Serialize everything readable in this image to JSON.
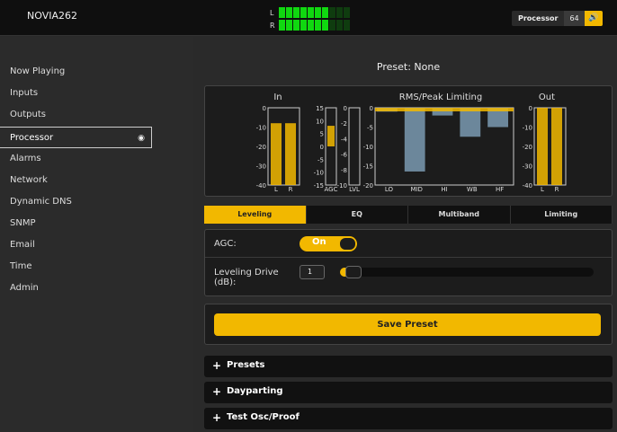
{
  "header": {
    "device_name": "NOVIA262",
    "vu": {
      "left_label": "L",
      "right_label": "R",
      "left_level": 0.7,
      "right_level": 0.7
    },
    "processor_label": "Processor",
    "processor_value": "64",
    "volume_icon": "speaker-icon"
  },
  "sidebar": {
    "items": [
      {
        "label": "Now Playing"
      },
      {
        "label": "Inputs"
      },
      {
        "label": "Outputs"
      },
      {
        "label": "Processor",
        "active": true
      },
      {
        "label": "Alarms"
      },
      {
        "label": "Network"
      },
      {
        "label": "Dynamic DNS"
      },
      {
        "label": "SNMP"
      },
      {
        "label": "Email"
      },
      {
        "label": "Time"
      },
      {
        "label": "Admin"
      }
    ]
  },
  "main": {
    "preset_title": "Preset: None",
    "meters": {
      "in_title": "In",
      "rms_title": "RMS/Peak Limiting",
      "out_title": "Out",
      "in_ticks": [
        "0",
        "-10",
        "-20",
        "-30",
        "-40"
      ],
      "agc_ticks": [
        "15",
        "10",
        "5",
        "0",
        "-5",
        "-10",
        "-15"
      ],
      "lvl_ticks": [
        "0",
        "-2",
        "-4",
        "-6",
        "-8",
        "-10"
      ],
      "lim_ticks": [
        "0",
        "-5",
        "-10",
        "-15",
        "-20"
      ],
      "out_ticks": [
        "0",
        "-10",
        "-20",
        "-30",
        "-40"
      ],
      "in_labels": [
        "L",
        "R"
      ],
      "agc_label": "AGC",
      "lvl_label": "LVL",
      "lim_labels": [
        "LO",
        "MID",
        "HI",
        "WB",
        "HF"
      ],
      "out_labels": [
        "L",
        "R"
      ],
      "in_levels_db": [
        -8,
        -8
      ],
      "agc_value_db": 8,
      "lim_values_db": [
        -1,
        -16.5,
        -2,
        -7.5,
        -5
      ],
      "out_levels_db": [
        0,
        0
      ]
    },
    "tabs": [
      {
        "label": "Leveling",
        "active": true
      },
      {
        "label": "EQ"
      },
      {
        "label": "Multiband"
      },
      {
        "label": "Limiting"
      }
    ],
    "leveling": {
      "agc_label": "AGC:",
      "agc_state": "On",
      "drive_label": "Leveling Drive (dB):",
      "drive_value": "1",
      "drive_fraction": 0.02
    },
    "save_label": "Save Preset",
    "accordions": [
      {
        "label": "Presets"
      },
      {
        "label": "Dayparting"
      },
      {
        "label": "Test Osc/Proof"
      }
    ]
  },
  "colors": {
    "accent": "#f2b800",
    "meter_blue": "#7a9ab2",
    "vu_green": "#10d810"
  }
}
